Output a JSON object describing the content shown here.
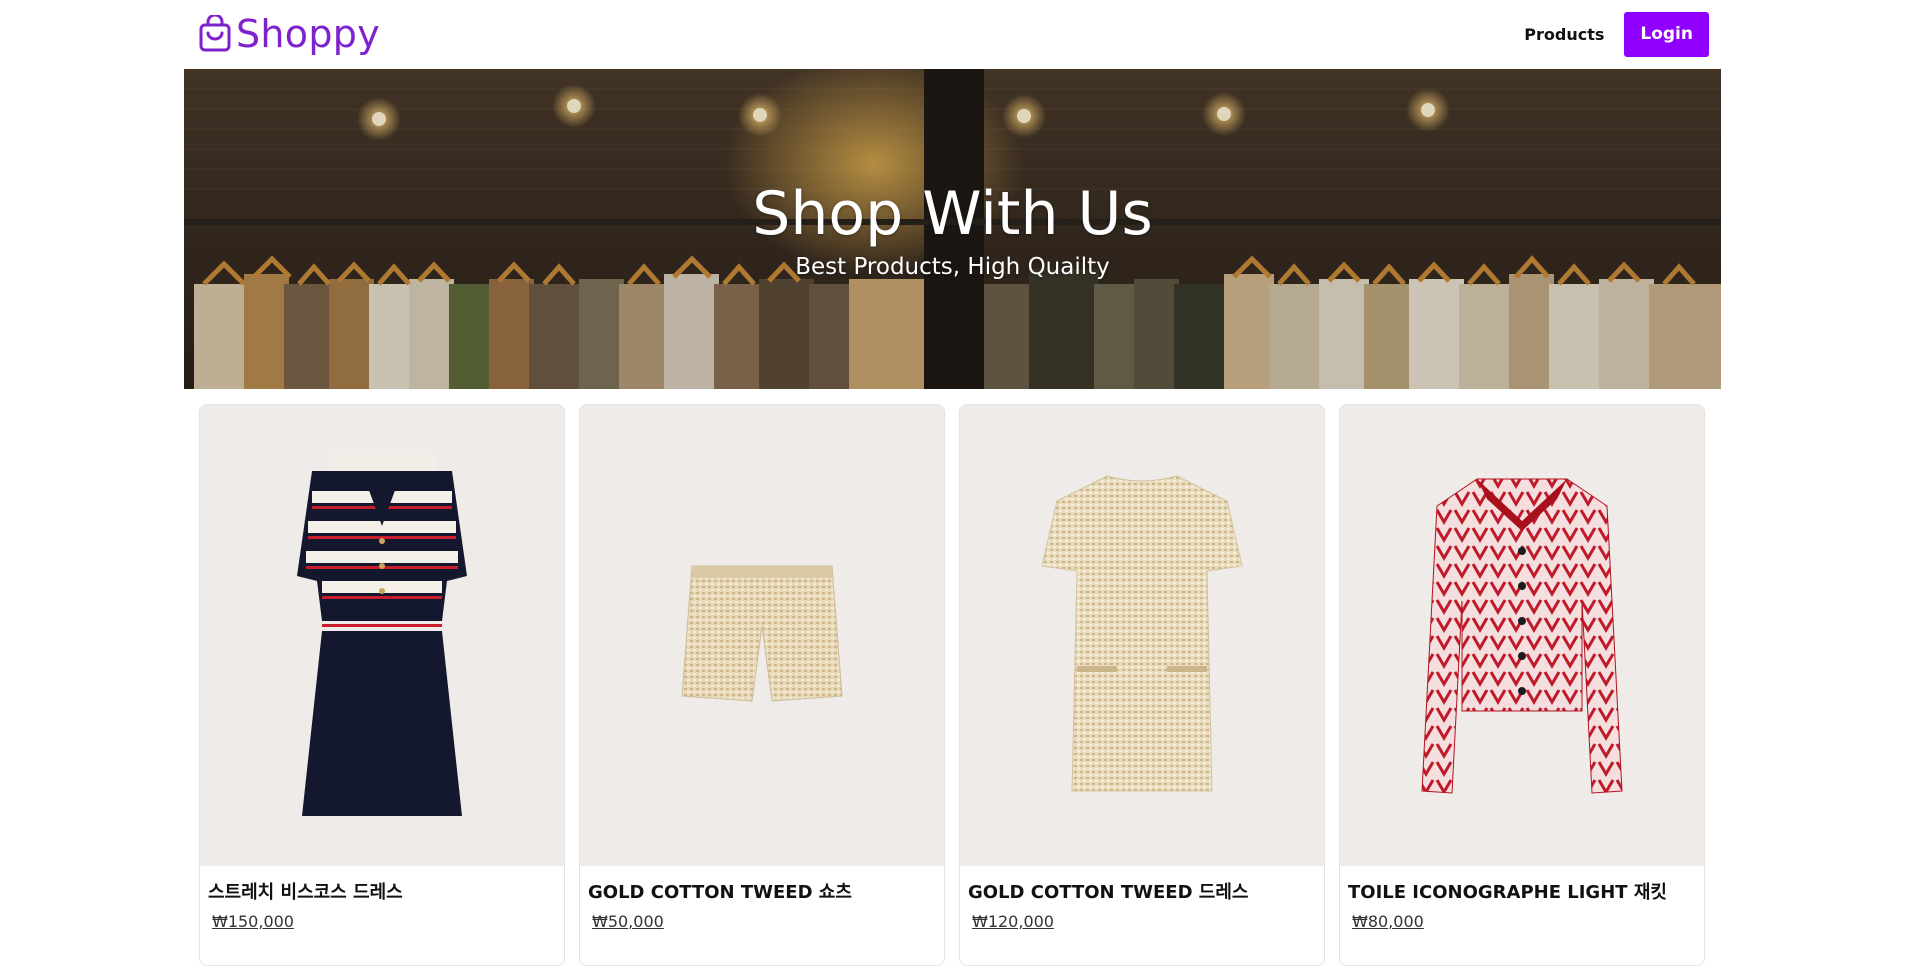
{
  "header": {
    "logo_text": "Shoppy",
    "nav_products": "Products",
    "login_label": "Login"
  },
  "banner": {
    "title": "Shop With Us",
    "subtitle": "Best Products, High Quailty"
  },
  "products": [
    {
      "name": "스트레치 비스코스 드레스",
      "price": "₩150,000"
    },
    {
      "name": "GOLD COTTON TWEED 쇼츠",
      "price": "₩50,000"
    },
    {
      "name": "GOLD COTTON TWEED 드레스",
      "price": "₩120,000"
    },
    {
      "name": "TOILE ICONOGRAPHE LIGHT 재킷",
      "price": "₩80,000"
    }
  ],
  "colors": {
    "brand": "#7e22ce",
    "button": "#8f00ff",
    "card_image_bg": "#efebe9"
  }
}
